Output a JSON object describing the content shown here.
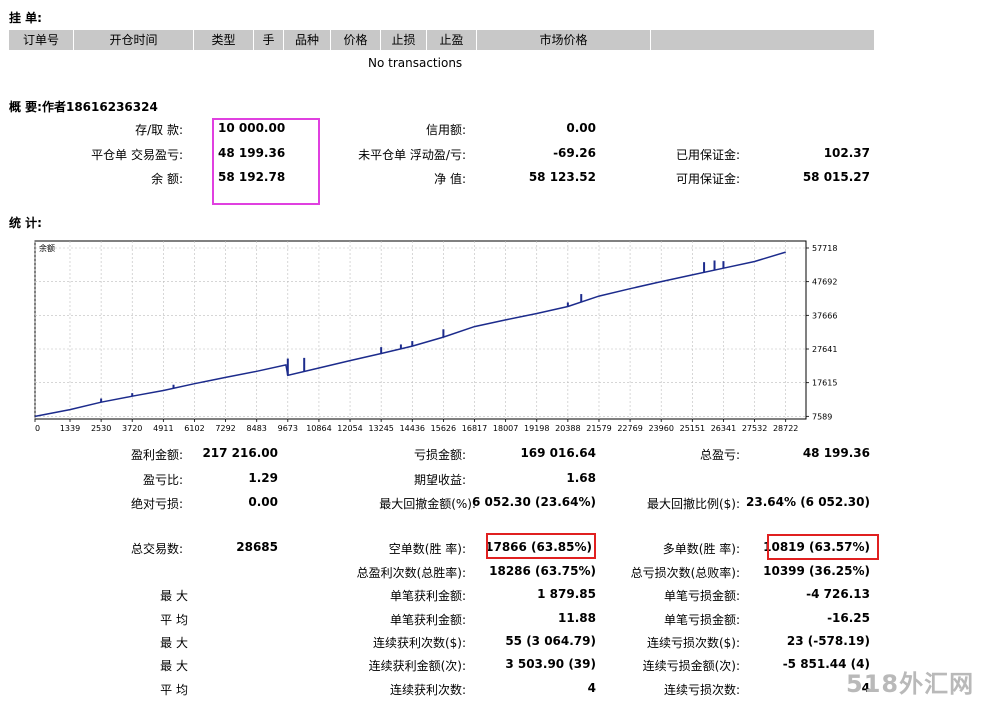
{
  "pending": {
    "title": "挂 单:",
    "columns": [
      "订单号",
      "开仓时间",
      "类型",
      "手",
      "品种",
      "价格",
      "止损",
      "止盈",
      "市场价格"
    ],
    "empty_text": "No transactions"
  },
  "summary": {
    "title": "概 要:作者18616236324",
    "col1": [
      {
        "label": "存/取 款:",
        "value": "10 000.00"
      },
      {
        "label": "平仓单 交易盈亏:",
        "value": "48 199.36"
      },
      {
        "label": "余 额:",
        "value": "58 192.78"
      }
    ],
    "col2": [
      {
        "label": "信用额:",
        "value": "0.00"
      },
      {
        "label": "未平仓单 浮动盈/亏:",
        "value": "-69.26"
      },
      {
        "label": "净 值:",
        "value": "58 123.52"
      }
    ],
    "col3": [
      {
        "label": "",
        "value": ""
      },
      {
        "label": "已用保证金:",
        "value": "102.37"
      },
      {
        "label": "可用保证金:",
        "value": "58 015.27"
      }
    ]
  },
  "stats_title": "统 计:",
  "chart_data": {
    "type": "line",
    "series": [
      {
        "name": "余额",
        "x": [
          0,
          1339,
          2530,
          3720,
          4911,
          6102,
          7292,
          8483,
          9600,
          9673,
          10864,
          12054,
          13245,
          14436,
          15626,
          16817,
          18007,
          19198,
          20388,
          21579,
          22769,
          23960,
          25151,
          26341,
          27532,
          28722
        ],
        "y": [
          7589,
          9600,
          11800,
          13600,
          15300,
          17300,
          19200,
          21000,
          22900,
          19800,
          22000,
          24200,
          26300,
          28500,
          31200,
          34300,
          36300,
          38200,
          40300,
          43400,
          45600,
          47700,
          49700,
          51700,
          53700,
          56500
        ]
      }
    ],
    "spikes": [
      {
        "x": 2530,
        "y": 12900
      },
      {
        "x": 3720,
        "y": 14500
      },
      {
        "x": 5300,
        "y": 17000
      },
      {
        "x": 9673,
        "y": 24800
      },
      {
        "x": 10300,
        "y": 25000
      },
      {
        "x": 13245,
        "y": 28200
      },
      {
        "x": 14000,
        "y": 29000
      },
      {
        "x": 14436,
        "y": 30000
      },
      {
        "x": 15626,
        "y": 33500
      },
      {
        "x": 20388,
        "y": 41500
      },
      {
        "x": 20900,
        "y": 44000
      },
      {
        "x": 25600,
        "y": 53500
      },
      {
        "x": 26000,
        "y": 54000
      },
      {
        "x": 26341,
        "y": 53800
      }
    ],
    "x_ticks": [
      0,
      1339,
      2530,
      3720,
      4911,
      6102,
      7292,
      8483,
      9673,
      10864,
      12054,
      13245,
      14436,
      15626,
      16817,
      18007,
      19198,
      20388,
      21579,
      22769,
      23960,
      25151,
      26341,
      27532,
      28722
    ],
    "y_ticks": [
      7589,
      17615,
      27641,
      37666,
      47692,
      57718
    ],
    "xlim": [
      0,
      29500
    ],
    "ylim": [
      6800,
      59800
    ],
    "legend_label": "余额",
    "grid": true,
    "line_color": "#1c2b8c"
  },
  "stats": {
    "row1": [
      {
        "label": "盈利金额:",
        "value": "217 216.00"
      },
      {
        "label": "亏损金额:",
        "value": "169 016.64"
      },
      {
        "label": "总盈亏:",
        "value": "48 199.36"
      }
    ],
    "row2": [
      {
        "label": "盈亏比:",
        "value": "1.29"
      },
      {
        "label": "期望收益:",
        "value": "1.68"
      }
    ],
    "row3": [
      {
        "label": "绝对亏损:",
        "value": "0.00"
      },
      {
        "label": "最大回撤金额(%):",
        "value": "6 052.30 (23.64%)"
      },
      {
        "label": "最大回撤比例($):",
        "value": "23.64% (6 052.30)"
      }
    ],
    "total_trades": {
      "label": "总交易数:",
      "value": "28685"
    },
    "short": {
      "label": "空单数(胜 率):",
      "value": "17866 (63.85%)"
    },
    "long": {
      "label": "多单数(胜 率):",
      "value": "10819 (63.57%)"
    },
    "win_total": {
      "label": "总盈利次数(总胜率):",
      "value": "18286 (63.75%)"
    },
    "loss_total": {
      "label": "总亏损次数(总败率):",
      "value": "10399 (36.25%)"
    },
    "left_labels": [
      "最 大",
      "平 均",
      "最 大",
      "最 大",
      "平 均"
    ],
    "mid": [
      {
        "label": "单笔获利金额:",
        "value": "1 879.85"
      },
      {
        "label": "单笔获利金额:",
        "value": "11.88"
      },
      {
        "label": "连续获利次数($):",
        "value": "55 (3 064.79)"
      },
      {
        "label": "连续获利金额(次):",
        "value": "3 503.90 (39)"
      },
      {
        "label": "连续获利次数:",
        "value": "4"
      }
    ],
    "right": [
      {
        "label": "单笔亏损金额:",
        "value": "-4 726.13"
      },
      {
        "label": "单笔亏损金额:",
        "value": "-16.25"
      },
      {
        "label": "连续亏损次数($):",
        "value": "23 (-578.19)"
      },
      {
        "label": "连续亏损金额(次):",
        "value": "-5 851.44 (4)"
      },
      {
        "label": "连续亏损次数:",
        "value": "4"
      }
    ]
  },
  "watermark": "518外汇网"
}
